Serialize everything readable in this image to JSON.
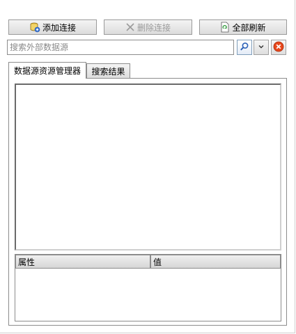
{
  "toolbar": {
    "add_label": "添加连接",
    "delete_label": "删除连接",
    "refresh_label": "全部刷新"
  },
  "search": {
    "placeholder": "搜索外部数据源",
    "value": ""
  },
  "tabs": [
    {
      "label": "数据源资源管理器",
      "selected": true
    },
    {
      "label": "搜索结果",
      "selected": false
    }
  ],
  "property_grid": {
    "columns": [
      "属性",
      "值"
    ]
  },
  "icons": {
    "add": "database-add-icon",
    "delete": "x-icon",
    "refresh": "document-refresh-icon",
    "search": "magnifier-icon",
    "dropdown": "chevron-down-icon",
    "clear": "clear-red-icon"
  },
  "colors": {
    "clear_red": "#e8481c",
    "search_blue": "#2b61b8",
    "disabled_text": "#9b9b9b"
  }
}
